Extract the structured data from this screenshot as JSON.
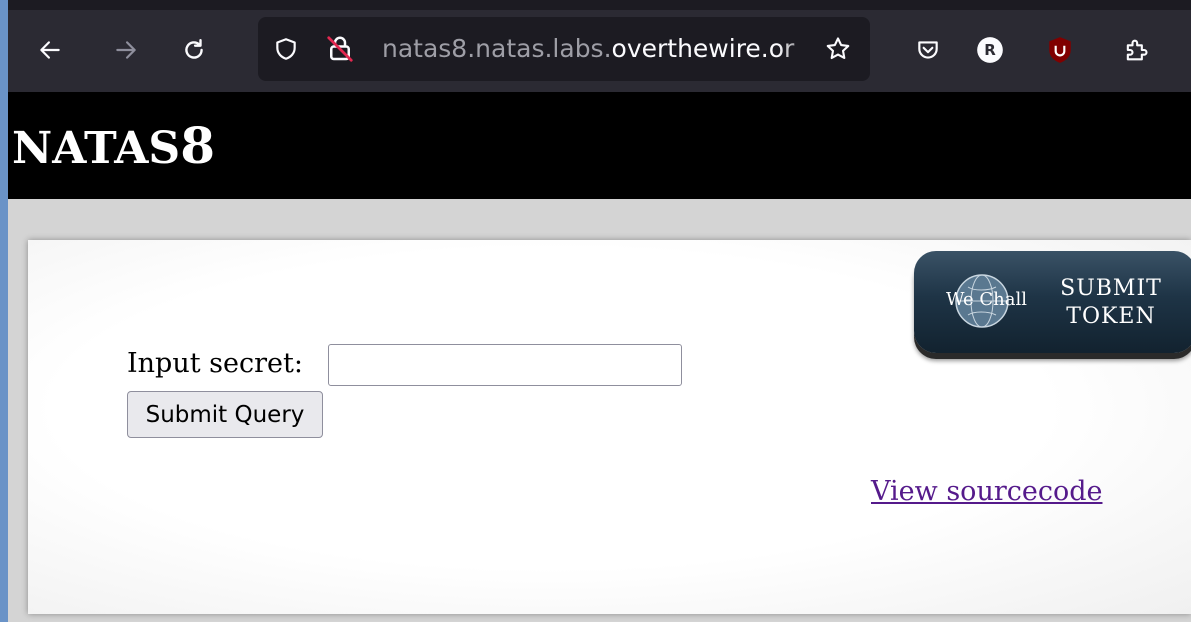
{
  "browser": {
    "url_prefix": "natas8.natas.labs.",
    "url_domain": "overthewire.or",
    "icons": {
      "back": "back-arrow-icon",
      "forward": "forward-arrow-icon",
      "reload": "reload-icon",
      "shield": "tracking-protection-shield-icon",
      "insecure": "insecure-lock-icon",
      "bookmark": "star-icon",
      "pocket": "pocket-icon",
      "ext_r": "extension-r-icon",
      "ublock": "ublock-origin-icon",
      "extensions": "extensions-puzzle-icon"
    },
    "ext_r_label": "R"
  },
  "page": {
    "title_big": "NATAS",
    "title_num": "8",
    "wechall": {
      "brand": "We Chall",
      "line1": "SUBMIT",
      "line2": "TOKEN"
    },
    "form": {
      "label": "Input secret:",
      "input_value": "",
      "submit_label": "Submit Query"
    },
    "source_link": "View sourcecode"
  },
  "colors": {
    "header_bg": "#000000",
    "link": "#551a8b",
    "toolbar": "#2b2a33"
  }
}
